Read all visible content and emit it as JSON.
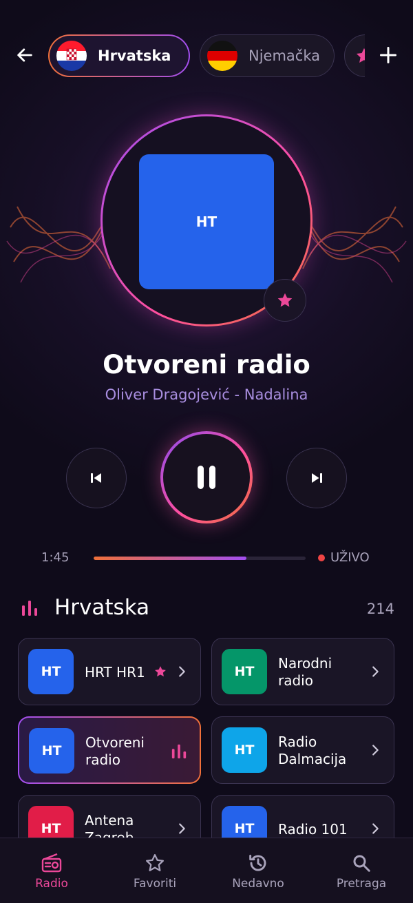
{
  "header": {
    "countries": [
      {
        "label": "Hrvatska",
        "selected": true
      },
      {
        "label": "Njemačka",
        "selected": false
      },
      {
        "label": "",
        "selected": false
      }
    ]
  },
  "player": {
    "cover_label": "HT",
    "station": "Otvoreni radio",
    "now_playing": "Oliver Dragojević - Nadalina",
    "elapsed": "1:45",
    "progress": 0.72,
    "live_label": "UŽIVO"
  },
  "section": {
    "title": "Hrvatska",
    "count": "214"
  },
  "stations": [
    {
      "logo": "HT",
      "name": "HRT HR1",
      "color": "#2563eb",
      "favorite": true,
      "active": false
    },
    {
      "logo": "HT",
      "name": "Narodni radio",
      "color": "#059669",
      "favorite": false,
      "active": false
    },
    {
      "logo": "HT",
      "name": "Otvoreni radio",
      "color": "#2563eb",
      "favorite": false,
      "active": true
    },
    {
      "logo": "HT",
      "name": "Radio Dalmacija",
      "color": "#0ea5e9",
      "favorite": false,
      "active": false
    },
    {
      "logo": "HT",
      "name": "Antena Zagreb",
      "color": "#e11d48",
      "favorite": false,
      "active": false
    },
    {
      "logo": "HT",
      "name": "Radio 101",
      "color": "#2563eb",
      "favorite": false,
      "active": false
    }
  ],
  "nav": [
    {
      "label": "Radio",
      "icon": "radio-icon",
      "active": true
    },
    {
      "label": "Favoriti",
      "icon": "star-outline-icon",
      "active": false
    },
    {
      "label": "Nedavno",
      "icon": "history-icon",
      "active": false
    },
    {
      "label": "Pretraga",
      "icon": "search-icon",
      "active": false
    }
  ],
  "colors": {
    "accent_pink": "#ec4899",
    "accent_orange": "#f0703a",
    "accent_purple": "#a24ef0",
    "background": "#0f0b1a"
  }
}
